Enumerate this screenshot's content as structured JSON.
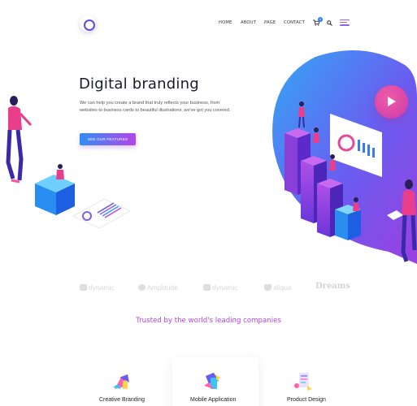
{
  "header": {
    "nav": [
      "HOME",
      "ABOUT",
      "PAGE",
      "CONTACT"
    ],
    "cart_count": "0"
  },
  "hero": {
    "title": "Digital branding",
    "text": "We can help you create a brand that truly reflects your business, from websites to business cards to beautiful illustrations, we've got you covered.",
    "button": "SEE OUR FEATURES"
  },
  "brands": [
    "dynamic",
    "Amplitude",
    "dynamic",
    "aliqua",
    "Dreams"
  ],
  "trusted": "Trusted by the world's leading companies",
  "services": [
    "Creative Branding",
    "Mobile Application",
    "Product Design"
  ],
  "colors": {
    "accent_purple": "#b145e0",
    "accent_blue": "#2f8ff3",
    "play_pink": "#e24aa6"
  },
  "icons": [
    "logo-icon",
    "cart-icon",
    "search-icon",
    "menu-icon",
    "play-icon"
  ]
}
